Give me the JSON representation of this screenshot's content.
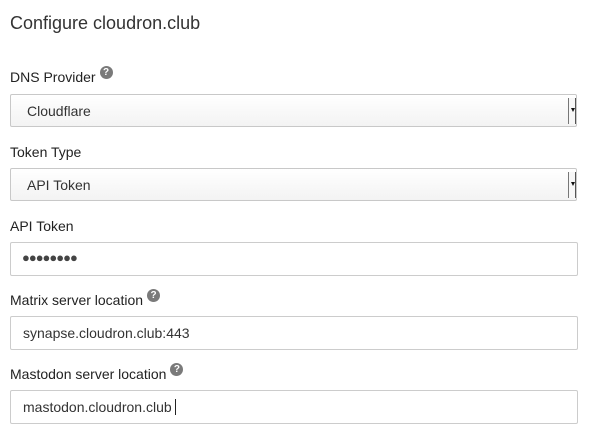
{
  "page": {
    "title": "Configure cloudron.club"
  },
  "dns_provider": {
    "label": "DNS Provider",
    "selected": "Cloudflare",
    "help_icon": "question-circle-icon"
  },
  "token_type": {
    "label": "Token Type",
    "selected": "API Token"
  },
  "api_token": {
    "label": "API Token",
    "masked_value": "●●●●●●●●"
  },
  "matrix": {
    "label": "Matrix server location",
    "value": "synapse.cloudron.club:443",
    "help_icon": "question-circle-icon"
  },
  "mastodon": {
    "label": "Mastodon server location",
    "value": "mastodon.cloudron.club",
    "help_icon": "question-circle-icon"
  }
}
